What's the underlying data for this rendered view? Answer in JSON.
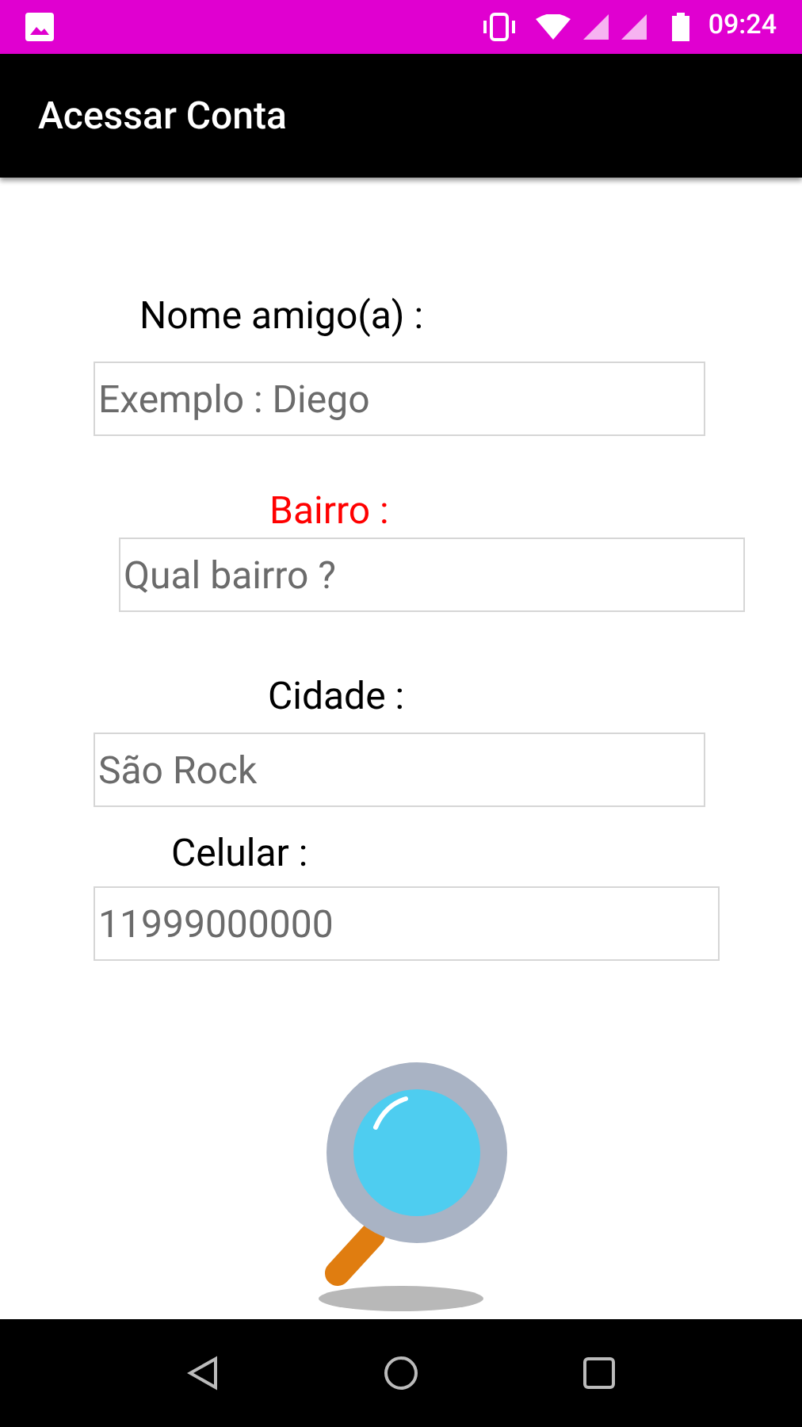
{
  "status_bar": {
    "time": "09:24"
  },
  "app_bar": {
    "title": "Acessar Conta"
  },
  "fields": [
    {
      "label": "Nome amigo(a) :",
      "color": "#000000",
      "placeholder": "Exemplo : Diego"
    },
    {
      "label": "Bairro :",
      "color": "#ff0000",
      "placeholder": "Qual bairro ?"
    },
    {
      "label": "Cidade :",
      "color": "#000000",
      "placeholder": "São Rock"
    },
    {
      "label": "Celular :",
      "color": "#000000",
      "placeholder": "11999000000"
    }
  ]
}
